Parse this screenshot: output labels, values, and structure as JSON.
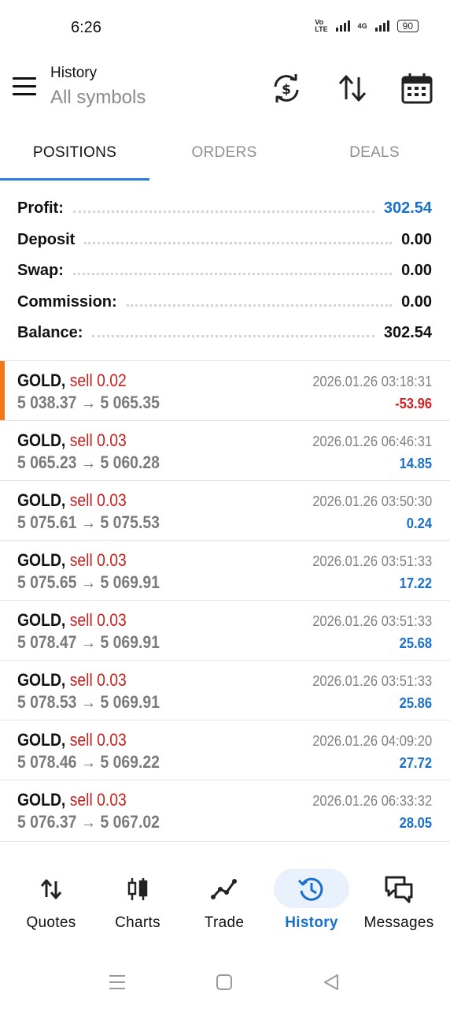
{
  "status_bar": {
    "time": "6:26",
    "network": "4G",
    "battery": "90"
  },
  "header": {
    "title": "History",
    "subtitle": "All symbols"
  },
  "tabs": [
    {
      "label": "POSITIONS",
      "active": true
    },
    {
      "label": "ORDERS",
      "active": false
    },
    {
      "label": "DEALS",
      "active": false
    }
  ],
  "summary": [
    {
      "label": "Profit:",
      "value": "302.54",
      "highlight": true
    },
    {
      "label": "Deposit",
      "value": "0.00",
      "highlight": false
    },
    {
      "label": "Swap:",
      "value": "0.00",
      "highlight": false
    },
    {
      "label": "Commission:",
      "value": "0.00",
      "highlight": false
    },
    {
      "label": "Balance:",
      "value": "302.54",
      "highlight": false
    }
  ],
  "trades": [
    {
      "symbol": "GOLD,",
      "side": "sell 0.02",
      "open": "5 038.37",
      "arrow": "→",
      "close": "5 065.35",
      "time": "2026.01.26 03:18:31",
      "profit": "-53.96",
      "negative": true,
      "selected": true
    },
    {
      "symbol": "GOLD,",
      "side": "sell 0.03",
      "open": "5 065.23",
      "arrow": "→",
      "close": "5 060.28",
      "time": "2026.01.26 06:46:31",
      "profit": "14.85",
      "negative": false,
      "selected": false
    },
    {
      "symbol": "GOLD,",
      "side": "sell 0.03",
      "open": "5 075.61",
      "arrow": "→",
      "close": "5 075.53",
      "time": "2026.01.26 03:50:30",
      "profit": "0.24",
      "negative": false,
      "selected": false
    },
    {
      "symbol": "GOLD,",
      "side": "sell 0.03",
      "open": "5 075.65",
      "arrow": "→",
      "close": "5 069.91",
      "time": "2026.01.26 03:51:33",
      "profit": "17.22",
      "negative": false,
      "selected": false
    },
    {
      "symbol": "GOLD,",
      "side": "sell 0.03",
      "open": "5 078.47",
      "arrow": "→",
      "close": "5 069.91",
      "time": "2026.01.26 03:51:33",
      "profit": "25.68",
      "negative": false,
      "selected": false
    },
    {
      "symbol": "GOLD,",
      "side": "sell 0.03",
      "open": "5 078.53",
      "arrow": "→",
      "close": "5 069.91",
      "time": "2026.01.26 03:51:33",
      "profit": "25.86",
      "negative": false,
      "selected": false
    },
    {
      "symbol": "GOLD,",
      "side": "sell 0.03",
      "open": "5 078.46",
      "arrow": "→",
      "close": "5 069.22",
      "time": "2026.01.26 04:09:20",
      "profit": "27.72",
      "negative": false,
      "selected": false
    },
    {
      "symbol": "GOLD,",
      "side": "sell 0.03",
      "open": "5 076.37",
      "arrow": "→",
      "close": "5 067.02",
      "time": "2026.01.26 06:33:32",
      "profit": "28.05",
      "negative": false,
      "selected": false
    }
  ],
  "nav": [
    {
      "label": "Quotes",
      "icon": "quotes-icon",
      "active": false
    },
    {
      "label": "Charts",
      "icon": "charts-icon",
      "active": false
    },
    {
      "label": "Trade",
      "icon": "trade-icon",
      "active": false
    },
    {
      "label": "History",
      "icon": "history-icon",
      "active": true
    },
    {
      "label": "Messages",
      "icon": "messages-icon",
      "active": false
    }
  ],
  "colors": {
    "accent_blue": "#1a6fcb",
    "loss_red": "#d42020",
    "sell_red": "#c81e1e",
    "selected_marker": "#f07a1a"
  }
}
